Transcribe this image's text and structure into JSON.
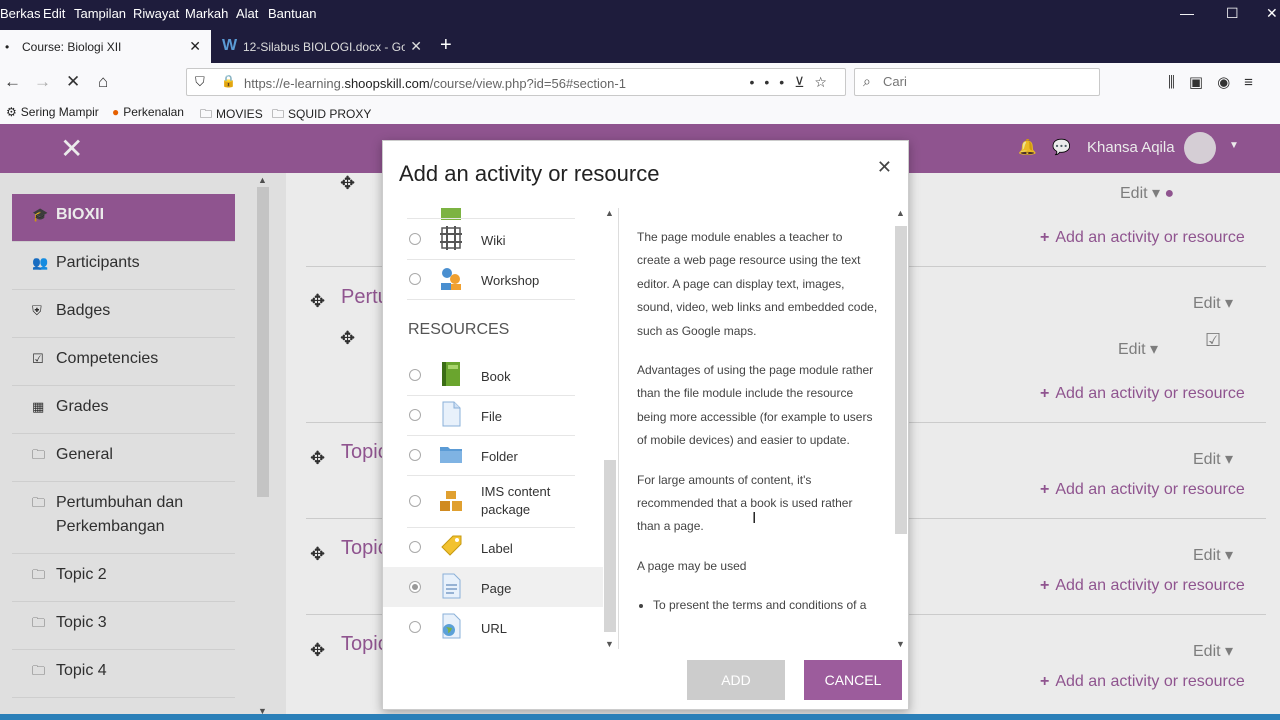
{
  "browser": {
    "menu": [
      "Berkas",
      "Edit",
      "Tampilan",
      "Riwayat",
      "Markah",
      "Alat",
      "Bantuan"
    ],
    "tabs": [
      {
        "title": "Course: Biologi XII",
        "active": true
      },
      {
        "title": "12-Silabus BIOLOGI.docx - Goo",
        "active": false
      }
    ],
    "url_prefix": "https://e-learning.",
    "url_domain": "shoopskill.com",
    "url_path": "/course/view.php?id=56#section-1",
    "search_placeholder": "Cari",
    "bookmarks": [
      "Sering Mampir",
      "Perkenalan",
      "MOVIES",
      "SQUID PROXY"
    ]
  },
  "header": {
    "user_name": "Khansa Aqila"
  },
  "sidebar": {
    "items": [
      {
        "label": "BIOXII",
        "icon": "graduation-cap-icon"
      },
      {
        "label": "Participants",
        "icon": "users-icon"
      },
      {
        "label": "Badges",
        "icon": "shield-icon"
      },
      {
        "label": "Competencies",
        "icon": "checkbox-icon"
      },
      {
        "label": "Grades",
        "icon": "table-icon"
      },
      {
        "label": "General",
        "icon": "folder-icon"
      },
      {
        "label": "Pertumbuhan dan Perkembangan",
        "icon": "folder-icon"
      },
      {
        "label": "Topic 2",
        "icon": "folder-icon"
      },
      {
        "label": "Topic 3",
        "icon": "folder-icon"
      },
      {
        "label": "Topic 4",
        "icon": "folder-icon"
      }
    ]
  },
  "main": {
    "edit_label": "Edit",
    "add_activity_label": "Add an activity or resource",
    "section_titles": [
      "Pertu",
      "Topic",
      "Topic",
      "Topic"
    ]
  },
  "modal": {
    "title": "Add an activity or resource",
    "close": "×",
    "activities": [
      {
        "label": "Wiki",
        "icon": "wiki-icon"
      },
      {
        "label": "Workshop",
        "icon": "workshop-icon"
      }
    ],
    "resources_heading": "RESOURCES",
    "resources": [
      {
        "label": "Book",
        "icon": "book-icon"
      },
      {
        "label": "File",
        "icon": "file-icon"
      },
      {
        "label": "Folder",
        "icon": "folder-icon"
      },
      {
        "label": "IMS content package",
        "icon": "package-icon"
      },
      {
        "label": "Label",
        "icon": "label-tag-icon"
      },
      {
        "label": "Page",
        "icon": "page-icon",
        "selected": true
      },
      {
        "label": "URL",
        "icon": "url-globe-icon"
      }
    ],
    "description": [
      "The page module enables a teacher to create a web page resource using the text editor. A page can display text, images, sound, video, web links and embedded code, such as Google maps.",
      "Advantages of using the page module rather than the file module include the resource being more accessible (for example to users of mobile devices) and easier to update.",
      "For large amounts of content, it's recommended that a book is used rather than a page.",
      "A page may be used"
    ],
    "description_bullets": [
      "To present the terms and conditions of a"
    ],
    "add_button": "ADD",
    "cancel_button": "CANCEL"
  },
  "colors": {
    "accent": "#9c5c9c",
    "chrome_dark": "#1e1c3c"
  }
}
